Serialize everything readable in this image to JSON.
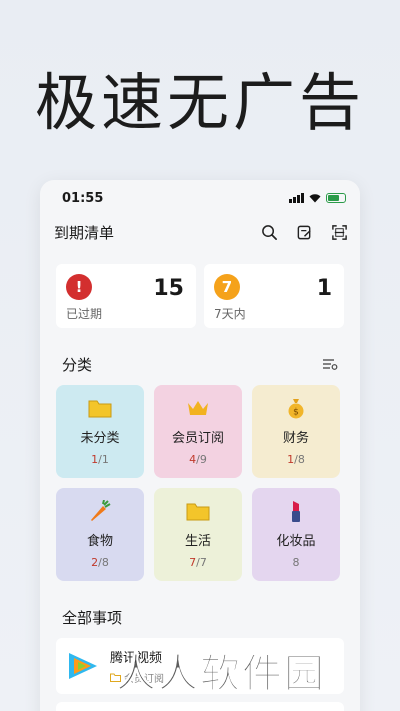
{
  "headline": "极速无广告",
  "status": {
    "time": "01:55"
  },
  "appbar": {
    "title": "到期清单"
  },
  "summary": [
    {
      "badge": "!",
      "label": "已过期",
      "count": "15",
      "color": "#d32f2f"
    },
    {
      "badge": "7",
      "label": "7天内",
      "count": "1",
      "color": "#f5a21b"
    }
  ],
  "categories_section": {
    "title": "分类"
  },
  "categories": [
    {
      "name": "未分类",
      "a": "1",
      "b": "/1",
      "icon": "folder-icon",
      "bg": "#cdeaf1"
    },
    {
      "name": "会员订阅",
      "a": "4",
      "b": "/9",
      "icon": "crown-icon",
      "bg": "#f3d2e1"
    },
    {
      "name": "财务",
      "a": "1",
      "b": "/8",
      "icon": "money-bag-icon",
      "bg": "#f5ecd0"
    },
    {
      "name": "食物",
      "a": "2",
      "b": "/8",
      "icon": "carrot-icon",
      "bg": "#d8daf0"
    },
    {
      "name": "生活",
      "a": "7",
      "b": "/7",
      "icon": "folder-icon",
      "bg": "#edf1d9"
    },
    {
      "name": "化妆品",
      "a": "",
      "b": "8",
      "icon": "lipstick-icon",
      "bg": "#e4d6ef"
    }
  ],
  "all_items_section": {
    "title": "全部事项"
  },
  "items": [
    {
      "name": "腾讯视频",
      "category": "会员订阅"
    }
  ],
  "watermark": "人人软件园"
}
